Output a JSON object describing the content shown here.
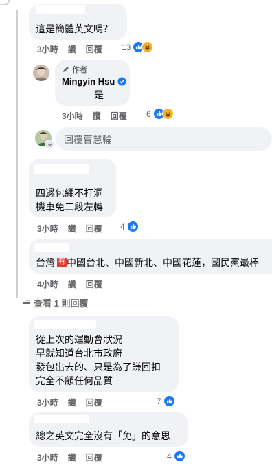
{
  "comments": [
    {
      "text": "這是簡體英文嗎？",
      "time": "3小時",
      "like": "讚",
      "reply": "回覆",
      "count": "13",
      "reactions": [
        "like",
        "haha"
      ]
    },
    {
      "author_badge": "作者",
      "author": "Mingyin Hsu",
      "text": "是",
      "time": "3小時",
      "like": "讚",
      "reply": "回覆",
      "count": "6",
      "reactions": [
        "like",
        "haha"
      ]
    },
    {
      "text": "四邊包繩不打洞\n機車免二段左轉",
      "time": "3小時",
      "like": "讚",
      "reply": "回覆",
      "count": "4",
      "reactions": [
        "like"
      ]
    },
    {
      "text_before": "台灣",
      "flag": "有",
      "text_after": " 中國台北、中國新北、中國花蓮，國民黨最棒",
      "time": "4小時",
      "like": "讚",
      "reply": "回覆"
    },
    {
      "text": "從上次的運動會狀況\n早就知道台北市政府\n發包出去的、只是為了賺回扣\n完全不顧任何品質",
      "time": "3小時",
      "like": "讚",
      "reply": "回覆",
      "count": "7",
      "reactions": [
        "like"
      ]
    },
    {
      "text": "總之英文完全沒有「免」的意思",
      "time": "3小時",
      "like": "讚",
      "reply": "回覆",
      "count": "4",
      "reactions": [
        "like"
      ]
    }
  ],
  "reply_box": {
    "placeholder": "回覆曹慧輪"
  },
  "view_replies": "查看 1 則回覆",
  "colors": {
    "bubble": "#f0f2f5",
    "meta": "#65676b",
    "like_blue": "#1877f2",
    "haha_yellow": "#f7b125",
    "verified": "#1877f2"
  }
}
